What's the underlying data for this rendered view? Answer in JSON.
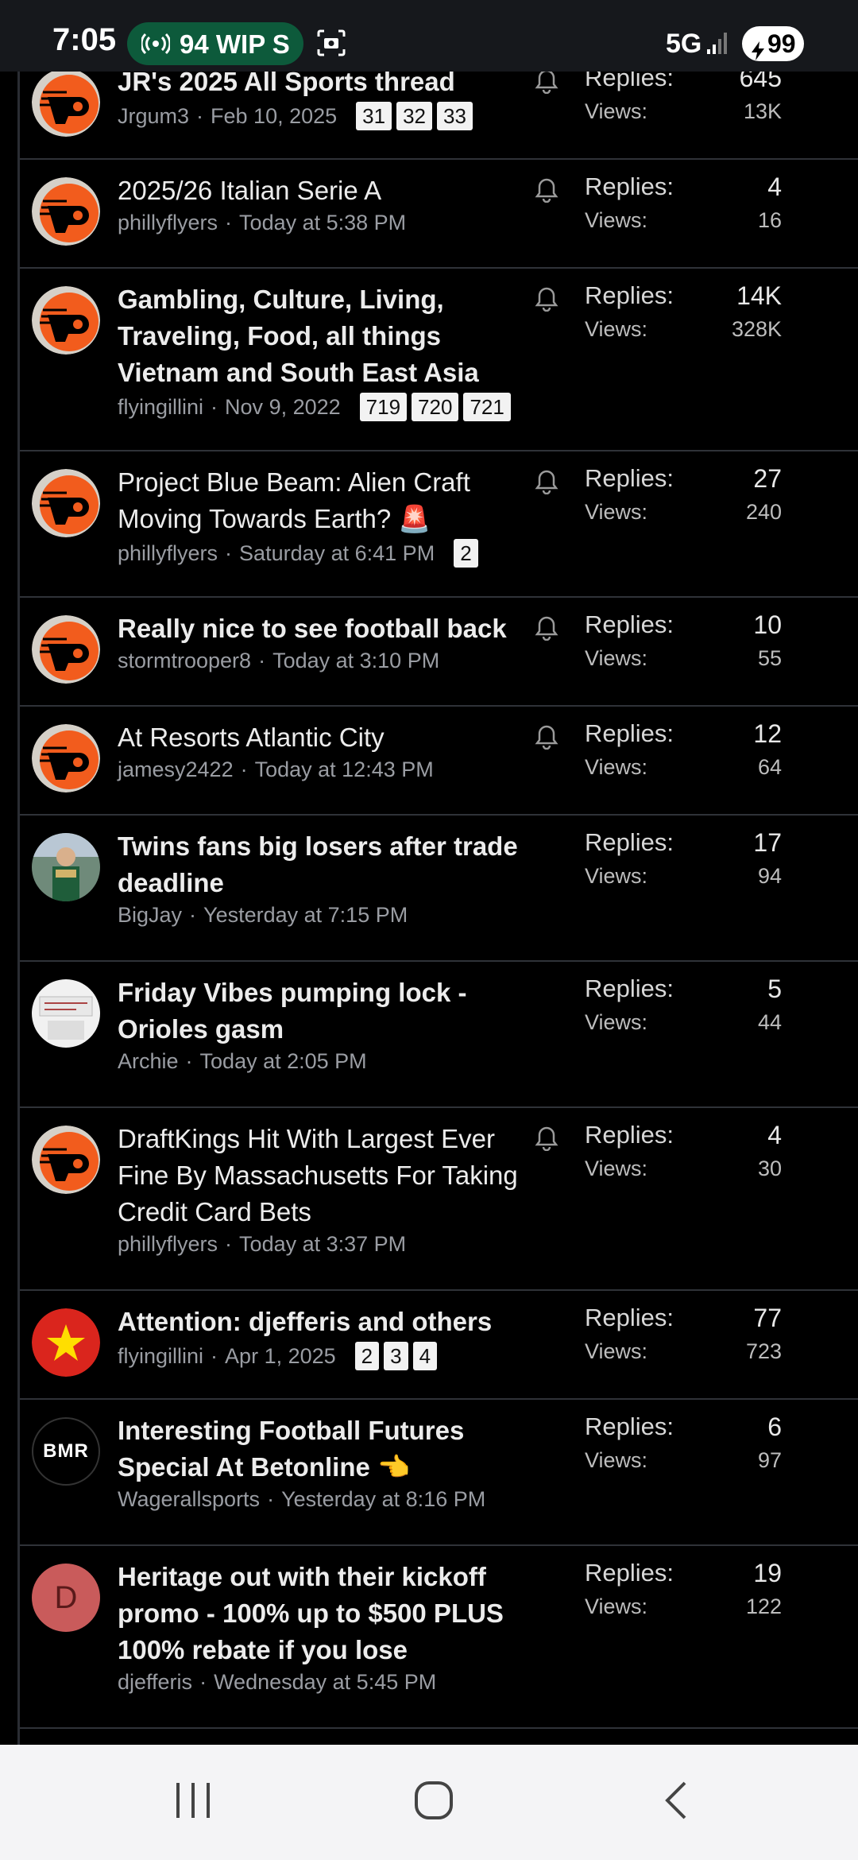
{
  "status_bar": {
    "time": "7:05",
    "call_pill": "94 WIP S",
    "network": "5G",
    "battery": "99"
  },
  "labels": {
    "replies": "Replies:",
    "views": "Views:",
    "separator": "·"
  },
  "threads": [
    {
      "title": "JR's 2025 All Sports thread",
      "author": "Jrgum3",
      "date": "Feb 10, 2025",
      "pages": [
        "31",
        "32",
        "33"
      ],
      "replies": "645",
      "views": "13K",
      "bold": true,
      "bell": true,
      "avatar": "flyers-logo"
    },
    {
      "title": "2025/26 Italian Serie A",
      "author": "phillyflyers",
      "date": "Today at 5:38 PM",
      "pages": [],
      "replies": "4",
      "views": "16",
      "bold": false,
      "bell": true,
      "avatar": "flyers-logo"
    },
    {
      "title": "Gambling, Culture, Living, Traveling, Food, all things Vietnam and South East Asia",
      "author": "flyingillini",
      "date": "Nov 9, 2022",
      "pages": [
        "719",
        "720",
        "721"
      ],
      "replies": "14K",
      "views": "328K",
      "bold": true,
      "bell": true,
      "avatar": "flyers-logo"
    },
    {
      "title": "Project Blue Beam: Alien Craft Moving Towards Earth? 🚨",
      "author": "phillyflyers",
      "date": "Saturday at 6:41 PM",
      "pages": [
        "2"
      ],
      "replies": "27",
      "views": "240",
      "bold": false,
      "bell": true,
      "avatar": "flyers-logo"
    },
    {
      "title": "Really nice to see football back",
      "author": "stormtrooper8",
      "date": "Today at 3:10 PM",
      "pages": [],
      "replies": "10",
      "views": "55",
      "bold": true,
      "bell": true,
      "avatar": "flyers-logo"
    },
    {
      "title": "At Resorts Atlantic City",
      "author": "jamesy2422",
      "date": "Today at 12:43 PM",
      "pages": [],
      "replies": "12",
      "views": "64",
      "bold": false,
      "bell": true,
      "avatar": "flyers-logo"
    },
    {
      "title": "Twins fans big losers after trade deadline",
      "author": "BigJay",
      "date": "Yesterday at 7:15 PM",
      "pages": [],
      "replies": "17",
      "views": "94",
      "bold": true,
      "bell": false,
      "avatar": "photo-person"
    },
    {
      "title": "Friday Vibes pumping lock - Orioles gasm",
      "author": "Archie",
      "date": "Today at 2:05 PM",
      "pages": [],
      "replies": "5",
      "views": "44",
      "bold": true,
      "bell": false,
      "avatar": "photo-sign"
    },
    {
      "title": "DraftKings Hit With Largest Ever Fine By Massachusetts For Taking Credit Card Bets",
      "author": "phillyflyers",
      "date": "Today at 3:37 PM",
      "pages": [],
      "replies": "4",
      "views": "30",
      "bold": false,
      "bell": true,
      "avatar": "flyers-logo"
    },
    {
      "title": "Attention: djefferis and others",
      "author": "flyingillini",
      "date": "Apr 1, 2025",
      "pages": [
        "2",
        "3",
        "4"
      ],
      "replies": "77",
      "views": "723",
      "bold": true,
      "bell": false,
      "avatar": "vietnam-flag"
    },
    {
      "title": "Interesting Football Futures Special At Betonline 👈",
      "author": "Wagerallsports",
      "date": "Yesterday at 8:16 PM",
      "pages": [],
      "replies": "6",
      "views": "97",
      "bold": true,
      "bell": false,
      "avatar": "bmr-logo",
      "avatar_text": "BMR"
    },
    {
      "title": "Heritage out with their kickoff promo - 100% up to $500 PLUS 100% rebate if you lose",
      "author": "djefferis",
      "date": "Wednesday at 5:45 PM",
      "pages": [],
      "replies": "19",
      "views": "122",
      "bold": true,
      "bell": false,
      "avatar": "letter-d",
      "avatar_text": "D"
    }
  ]
}
